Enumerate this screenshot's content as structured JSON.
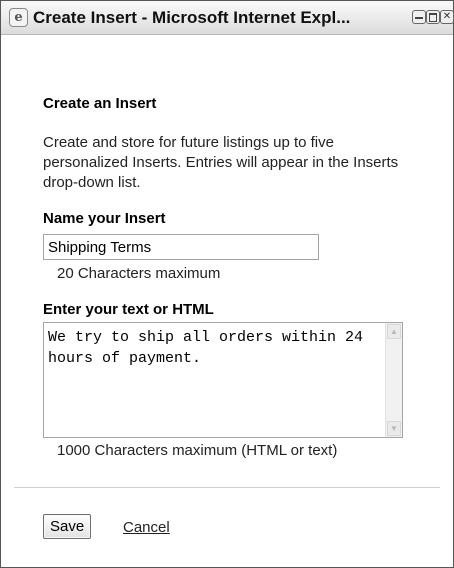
{
  "window": {
    "title": "Create Insert - Microsoft Internet Expl...",
    "icon": "ie-page-icon",
    "controls": [
      "minimize-icon",
      "maximize-icon",
      "close-icon"
    ]
  },
  "form": {
    "heading": "Create an Insert",
    "description": "Create and store for future listings up to five personalized Inserts. Entries will appear in the Inserts drop-down list.",
    "name_label": "Name your Insert",
    "name_value": "Shipping Terms",
    "name_hint": "20 Characters maximum",
    "text_label": "Enter your text or HTML",
    "text_value": "We try to ship all orders within 24 hours of payment.",
    "text_hint": "1000 Characters maximum (HTML or text)"
  },
  "actions": {
    "save_label": "Save",
    "cancel_label": "Cancel"
  }
}
